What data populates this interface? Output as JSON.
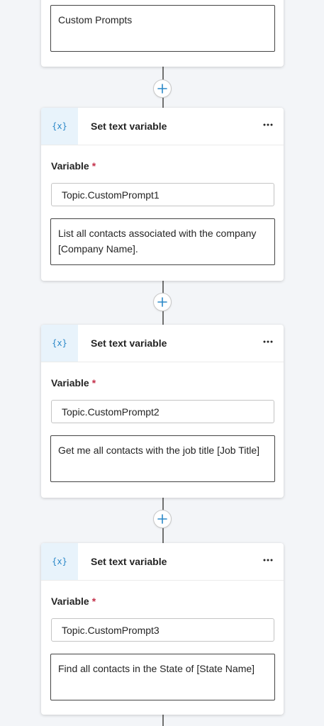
{
  "top_card": {
    "text_value": "Custom Prompts"
  },
  "nodes": [
    {
      "title": "Set text variable",
      "icon": "{x}",
      "variable_label": "Variable",
      "required_mark": "*",
      "variable_value": "Topic.CustomPrompt1",
      "text_value": "List all contacts associated with the company [Company Name]."
    },
    {
      "title": "Set text variable",
      "icon": "{x}",
      "variable_label": "Variable",
      "required_mark": "*",
      "variable_value": "Topic.CustomPrompt2",
      "text_value": "Get me all contacts with the job title [Job Title]"
    },
    {
      "title": "Set text variable",
      "icon": "{x}",
      "variable_label": "Variable",
      "required_mark": "*",
      "variable_value": "Topic.CustomPrompt3",
      "text_value": "Find all contacts in the State of [State Name]"
    }
  ],
  "colors": {
    "accent": "#2b88c8",
    "required": "#c4314b",
    "canvas": "#f3f5f8"
  }
}
